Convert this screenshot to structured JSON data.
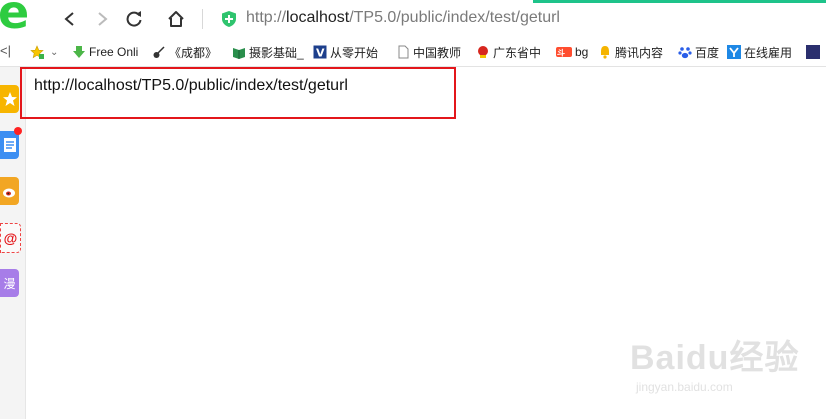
{
  "address_bar": {
    "url_scheme": "http://",
    "url_host": "localhost",
    "url_path": "/TP5.0/public/index/test/geturl"
  },
  "bookmarks": [
    {
      "label": "",
      "icon": "star-add-icon"
    },
    {
      "label": "Free Onli",
      "icon": "download-arrow-icon"
    },
    {
      "label": "《成都》",
      "icon": "guitar-icon"
    },
    {
      "label": "摄影基础_",
      "icon": "book-icon"
    },
    {
      "label": "从零开始",
      "icon": "v-badge-icon"
    },
    {
      "label": "中国教师",
      "icon": "page-icon"
    },
    {
      "label": "广东省中",
      "icon": "emblem-icon"
    },
    {
      "label": "bg",
      "icon": "douyu-icon"
    },
    {
      "label": "腾讯内容",
      "icon": "bell-icon"
    },
    {
      "label": "百度",
      "icon": "baidu-paw-icon"
    },
    {
      "label": "在线雇用",
      "icon": "y-logo-icon"
    }
  ],
  "sidebar": {
    "items": [
      {
        "icon": "star-icon",
        "color": "#f7b500"
      },
      {
        "icon": "note-icon",
        "color": "#3d8ff2",
        "badge": true
      },
      {
        "icon": "weibo-icon",
        "color": "#f0a020"
      },
      {
        "icon": "mail-at-icon",
        "color": "#e8e8e8"
      },
      {
        "icon": "manga-icon",
        "color": "#a77de8",
        "label": "漫"
      }
    ]
  },
  "content": {
    "url_text": "http://localhost/TP5.0/public/index/test/geturl"
  },
  "watermark": {
    "brand": "Baidu经验",
    "domain": "jingyan.baidu.com"
  },
  "colors": {
    "accent_green": "#1ec38a",
    "highlight_red": "#e3161b"
  }
}
